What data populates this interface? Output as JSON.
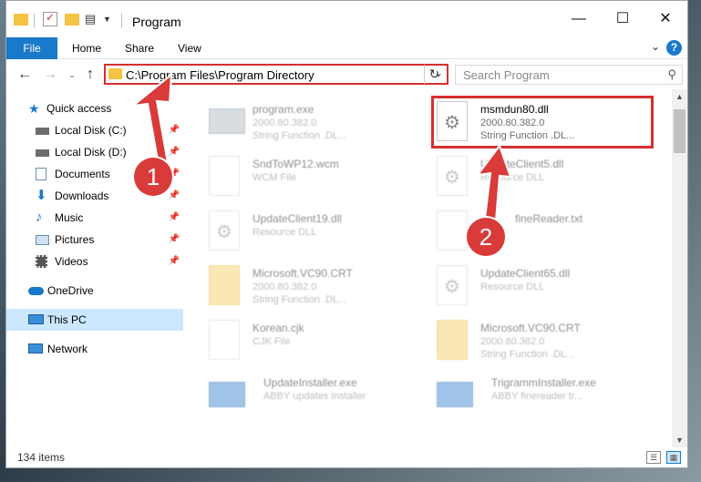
{
  "window": {
    "title": "Program",
    "controls": {
      "minimize": "—",
      "maximize": "☐",
      "close": "✕"
    }
  },
  "ribbon": {
    "tabs": [
      "File",
      "Home",
      "Share",
      "View"
    ],
    "help": "?"
  },
  "address": {
    "path": "C:\\Program Files\\Program Directory",
    "search_placeholder": "Search Program"
  },
  "nav": {
    "items": [
      {
        "label": "Quick access",
        "icon": "star-icon"
      },
      {
        "label": "Local Disk (C:)",
        "icon": "drive-icon"
      },
      {
        "label": "Local Disk (D:)",
        "icon": "drive-icon"
      },
      {
        "label": "Documents",
        "icon": "documents-icon"
      },
      {
        "label": "Downloads",
        "icon": "download-icon"
      },
      {
        "label": "Music",
        "icon": "music-icon"
      },
      {
        "label": "Pictures",
        "icon": "pictures-icon"
      },
      {
        "label": "Videos",
        "icon": "videos-icon"
      },
      {
        "label": "OneDrive",
        "icon": "cloud-icon"
      },
      {
        "label": "This PC",
        "icon": "computer-icon"
      },
      {
        "label": "Network",
        "icon": "network-icon"
      }
    ]
  },
  "files": [
    {
      "name": "program.exe",
      "line2": "2000.80.382.0",
      "line3": "String Function .DL..."
    },
    {
      "name": "msmdun80.dll",
      "line2": "2000.80.382.0",
      "line3": "String Function .DL..."
    },
    {
      "name": "SndToWP12.wcm",
      "line2": "WCM File",
      "line3": ""
    },
    {
      "name": "UpdateClient5.dll",
      "line2": "Resource DLL",
      "line3": ""
    },
    {
      "name": "UpdateClient19.dll",
      "line2": "Resource DLL",
      "line3": ""
    },
    {
      "name": "fineReader.txt",
      "line2": "",
      "line3": ""
    },
    {
      "name": "Microsoft.VC90.CRT",
      "line2": "2000.80.382.0",
      "line3": "String Function .DL..."
    },
    {
      "name": "UpdateClient65.dll",
      "line2": "Resource DLL",
      "line3": ""
    },
    {
      "name": "Korean.cjk",
      "line2": "CJK File",
      "line3": ""
    },
    {
      "name": "Microsoft.VC90.CRT",
      "line2": "2000.80.382.0",
      "line3": "String Function .DL..."
    },
    {
      "name": "UpdateInstaller.exe",
      "line2": "ABBY updates installer",
      "line3": ""
    },
    {
      "name": "TrigrammInstaller.exe",
      "line2": "ABBY finereader tr...",
      "line3": ""
    }
  ],
  "status": {
    "count": "134 items"
  },
  "annotations": {
    "badge1": "1",
    "badge2": "2"
  },
  "colors": {
    "accent": "#1979ca",
    "highlight": "#d62f2f"
  }
}
